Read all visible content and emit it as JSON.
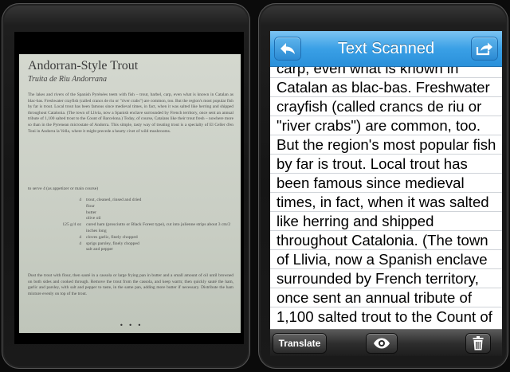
{
  "left_screen": {
    "page": {
      "title": "Andorran-Style Trout",
      "subtitle": "Truita de Riu Andorrana",
      "body": "The lakes and rivers of the Spanish Pyrénées teem with fish – trout, barbel, carp, even what is known in Catalan as blac-bas. Freshwater crayfish (called crancs de riu or \"river crabs\") are common, too. But the region's most popular fish by far is trout. Local trout has been famous since medieval times, in fact, when it was salted like herring and shipped throughout Catalonia. (The town of Llivia, now a Spanish enclave surrounded by French territory, once sent an annual tribute of 1,100 salted trout to the Count of Barcelona.) Today, of course, Catalans like their trout fresh – nowhere more so than in the Pyrenean microstate of Andorra. This simple, tasty way of treating trout is a specialty of El Celler d'en Toni in Andorra la Vella, where it might precede a hearty civet of wild mushrooms.",
      "serves": "to serve 4 (as appetizer or main course)",
      "ingredients": [
        {
          "qty": "4",
          "item": "trout, cleaned, rinsed and dried"
        },
        {
          "qty": "",
          "item": "flour"
        },
        {
          "qty": "",
          "item": "butter"
        },
        {
          "qty": "",
          "item": "olive oil"
        },
        {
          "qty": "125 g/4 oz",
          "item": "cured ham (prosciutto or Black Forest type), cut into julienne strips about 3 cm/2 inches long"
        },
        {
          "qty": "4",
          "item": "cloves garlic, finely chopped"
        },
        {
          "qty": "4",
          "item": "sprigs parsley, finely chopped"
        },
        {
          "qty": "",
          "item": "salt and pepper"
        }
      ],
      "method": "Dust the trout with flour, then sauté in a cassola or large frying pan in butter and a small amount of oil until browned on both sides and cooked through. Remove the trout from the cassola, and keep warm; then quickly sauté the ham, garlic and parsley, with salt and pepper to taste, in the same pan, adding more butter if necessary. Distribute the ham mixture evenly on top of the trout.",
      "ornament": "• • •"
    }
  },
  "right_screen": {
    "navbar": {
      "title": "Text Scanned",
      "back_icon": "back-arrow-icon",
      "share_icon": "share-icon",
      "color": "#3aa0e6"
    },
    "content": {
      "text": "carp, even what is known in\nCatalan as blac-bas. Freshwater\ncrayfish (called crancs de riu or\n\"river crabs\") are common, too.\nBut the region's most popular fish\nby far is trout. Local trout has\nbeen famous since medieval\ntimes, in fact, when it was salted\nlike herring and shipped\nthroughout Catalonia. (The town\nof Llivia, now a Spanish enclave\nsurrounded by French territory,\nonce sent an annual tribute of\n1,100 salted trout to the Count of\nBarcelona.) Today, of course,"
    },
    "toolbar": {
      "translate_label": "Translate",
      "eye_icon": "eye-icon",
      "trash_icon": "trash-icon"
    }
  }
}
